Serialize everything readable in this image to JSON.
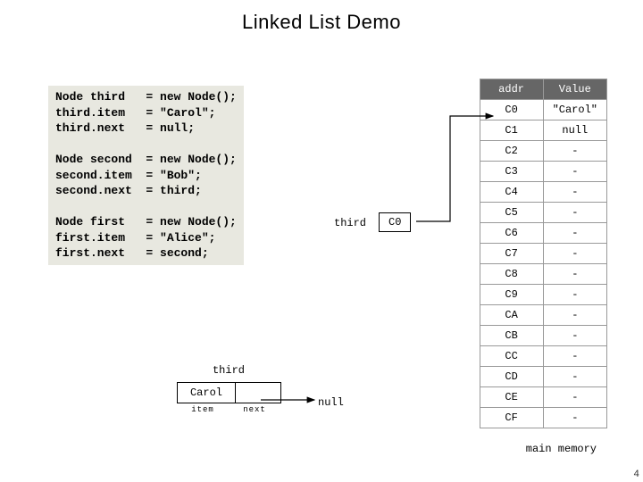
{
  "title": "Linked List Demo",
  "code": {
    "lines": [
      "Node third   = new Node();",
      "third.item   = \"Carol\";",
      "third.next   = null;",
      "",
      "Node second  = new Node();",
      "second.item  = \"Bob\";",
      "second.next  = third;",
      "",
      "Node first   = new Node();",
      "first.item   = \"Alice\";",
      "first.next   = second;"
    ]
  },
  "memory": {
    "headers": {
      "addr": "addr",
      "value": "Value"
    },
    "rows": [
      {
        "addr": "C0",
        "value": "\"Carol\""
      },
      {
        "addr": "C1",
        "value": "null"
      },
      {
        "addr": "C2",
        "value": "-"
      },
      {
        "addr": "C3",
        "value": "-"
      },
      {
        "addr": "C4",
        "value": "-"
      },
      {
        "addr": "C5",
        "value": "-"
      },
      {
        "addr": "C6",
        "value": "-"
      },
      {
        "addr": "C7",
        "value": "-"
      },
      {
        "addr": "C8",
        "value": "-"
      },
      {
        "addr": "C9",
        "value": "-"
      },
      {
        "addr": "CA",
        "value": "-"
      },
      {
        "addr": "CB",
        "value": "-"
      },
      {
        "addr": "CC",
        "value": "-"
      },
      {
        "addr": "CD",
        "value": "-"
      },
      {
        "addr": "CE",
        "value": "-"
      },
      {
        "addr": "CF",
        "value": "-"
      }
    ],
    "caption": "main memory"
  },
  "pointer_var": {
    "label": "third",
    "value": "C0"
  },
  "node": {
    "title": "third",
    "item": "Carol",
    "next": "null",
    "item_label": "item",
    "next_label": "next"
  },
  "slide_number": "4"
}
